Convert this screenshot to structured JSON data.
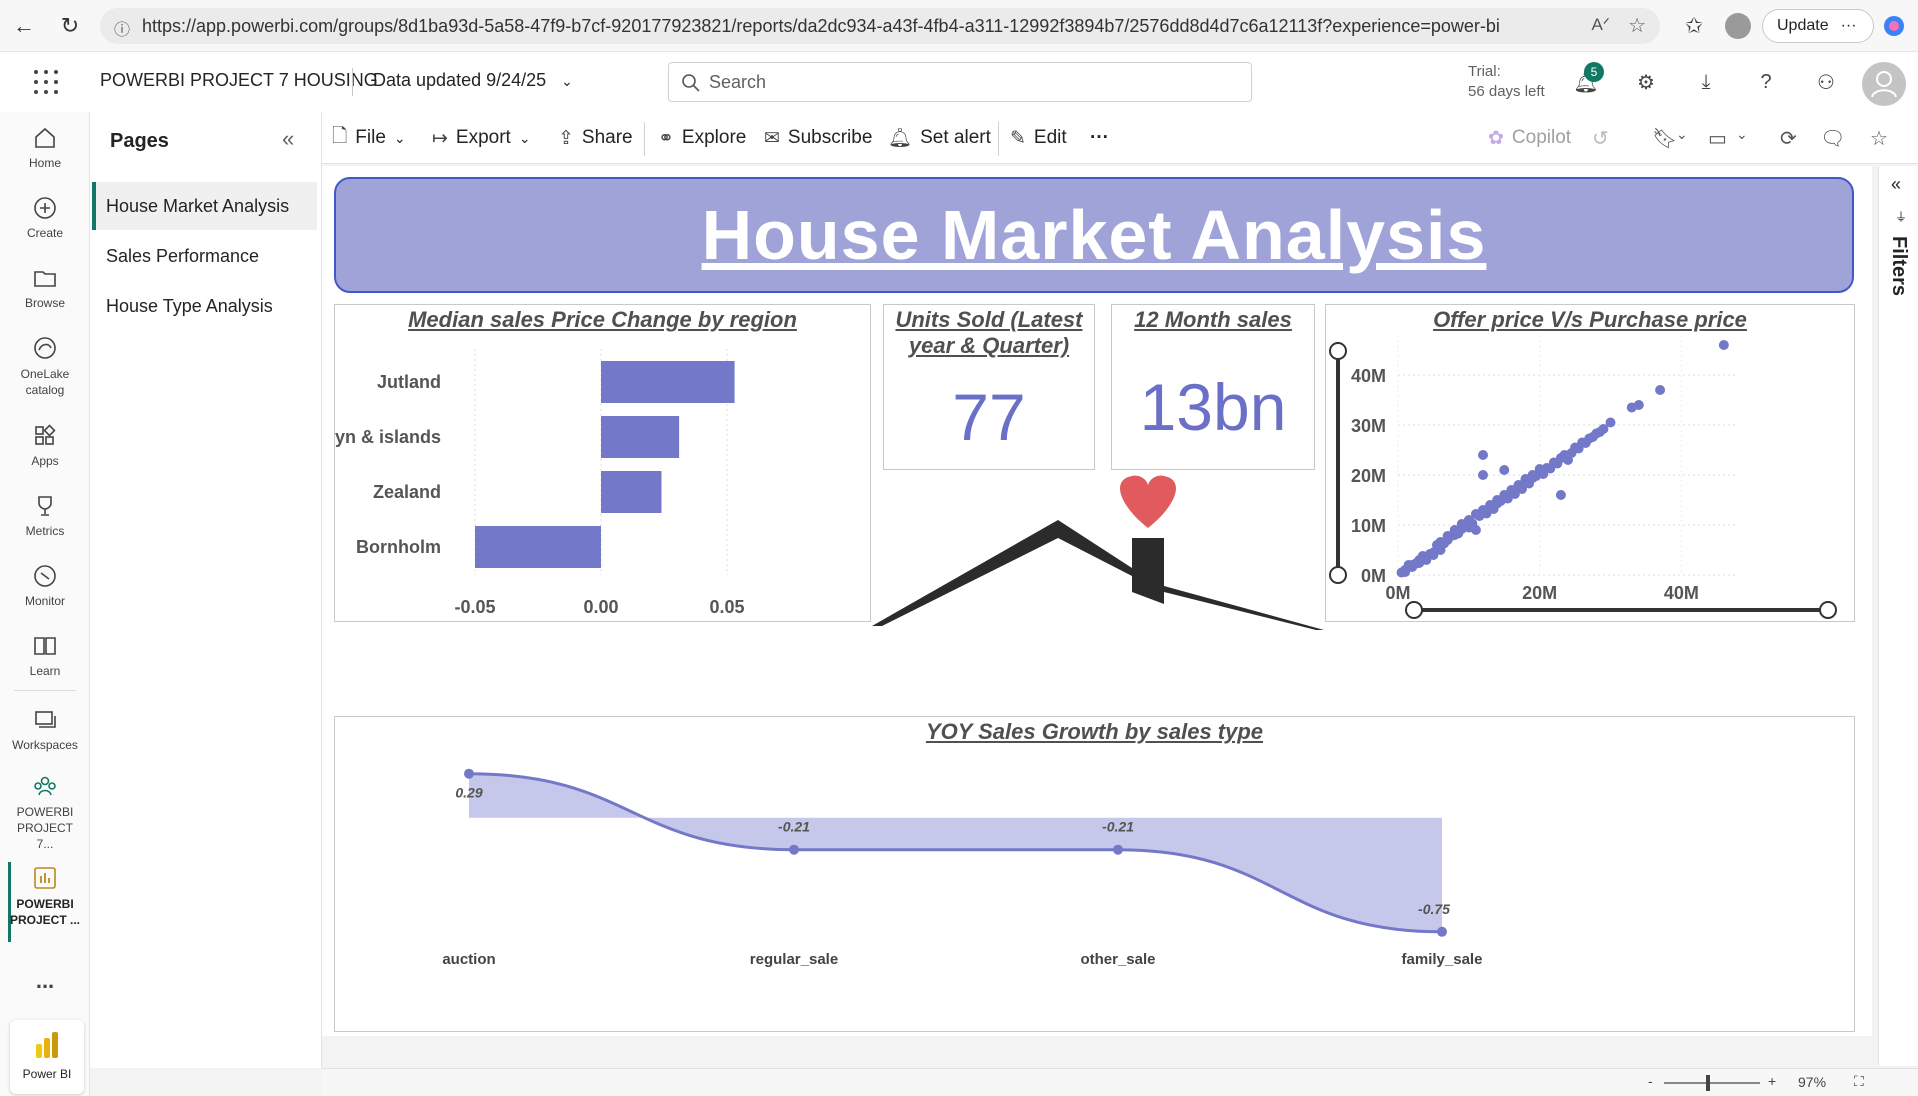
{
  "browser": {
    "url": "https://app.powerbi.com/groups/8d1ba93d-5a58-47f9-b7cf-920177923821/reports/da2dc934-a43f-4fb4-a311-12992f3894b7/2576dd8d4d7c6a12113f?experience=power-bi",
    "update_label": "Update"
  },
  "header": {
    "workspace_title": "POWERBI PROJECT 7 HOUSING",
    "data_updated": "Data updated 9/24/25",
    "search_placeholder": "Search",
    "trial_line1": "Trial:",
    "trial_line2": "56 days left",
    "notification_count": "5"
  },
  "rail": {
    "items": [
      {
        "label": "Home",
        "icon": "home-icon"
      },
      {
        "label": "Create",
        "icon": "plus-circle-icon"
      },
      {
        "label": "Browse",
        "icon": "folder-icon"
      },
      {
        "label": "OneLake catalog",
        "icon": "onelake-icon"
      },
      {
        "label": "Apps",
        "icon": "apps-icon"
      },
      {
        "label": "Metrics",
        "icon": "trophy-icon"
      },
      {
        "label": "Monitor",
        "icon": "monitor-icon"
      },
      {
        "label": "Learn",
        "icon": "book-icon"
      },
      {
        "label": "Workspaces",
        "icon": "workspaces-icon"
      },
      {
        "label": "POWERBI PROJECT 7...",
        "icon": "workspace-people-icon"
      },
      {
        "label": "POWERBI PROJECT ...",
        "icon": "report-icon"
      }
    ],
    "more": "...",
    "power_bi_label": "Power BI"
  },
  "pages": {
    "title": "Pages",
    "items": [
      "House Market Analysis",
      "Sales Performance",
      "House Type Analysis"
    ]
  },
  "toolbar": {
    "file": "File",
    "export": "Export",
    "share": "Share",
    "explore": "Explore",
    "subscribe": "Subscribe",
    "set_alert": "Set alert",
    "edit": "Edit",
    "more": "···",
    "copilot": "Copilot"
  },
  "report": {
    "banner_title": "House Market Analysis",
    "kpis": [
      {
        "title": "Units Sold (Latest year & Quarter)",
        "value": "77"
      },
      {
        "title": "12 Month sales",
        "value": "13bn"
      }
    ]
  },
  "filters_label": "Filters",
  "status": {
    "zoom": "97%",
    "minus": "-",
    "plus": "+"
  },
  "colors": {
    "accent": "#6a70c6",
    "bar": "#7378c8",
    "banner": "#9fa3d8",
    "heart": "#e05a5e",
    "house": "#2b2b2b"
  },
  "chart_data": [
    {
      "type": "bar",
      "orientation": "horizontal",
      "title": "Median sales Price Change by region",
      "categories": [
        "Jutland",
        "Fyn & islands",
        "Zealand",
        "Bornholm"
      ],
      "values": [
        0.053,
        0.031,
        0.024,
        -0.05
      ],
      "xlim": [
        -0.05,
        0.05
      ],
      "xticks": [
        "-0.05",
        "0.00",
        "0.05"
      ],
      "grid": true
    },
    {
      "type": "scatter",
      "title": "Offer price V/s Purchase price",
      "xticks": [
        "0M",
        "20M",
        "40M"
      ],
      "yticks": [
        "0M",
        "10M",
        "20M",
        "30M",
        "40M"
      ],
      "xlim": [
        0,
        48
      ],
      "ylim": [
        0,
        48
      ],
      "points": [
        [
          46,
          46
        ],
        [
          37,
          37
        ],
        [
          34,
          34
        ],
        [
          33,
          33.5
        ],
        [
          30,
          30.5
        ],
        [
          24,
          23
        ],
        [
          23,
          16
        ],
        [
          18,
          19
        ],
        [
          15,
          21
        ],
        [
          12,
          24
        ],
        [
          12,
          20
        ],
        [
          11,
          9
        ],
        [
          10,
          9.5
        ],
        [
          8,
          8
        ],
        [
          7,
          7
        ],
        [
          6,
          5
        ],
        [
          5,
          4.5
        ],
        [
          4,
          3.5
        ],
        [
          3,
          3
        ],
        [
          2,
          2
        ],
        [
          1,
          1
        ],
        [
          0.5,
          0.5
        ],
        [
          1.5,
          2
        ],
        [
          2.5,
          2.3
        ],
        [
          3.5,
          3.8
        ],
        [
          4.5,
          4.2
        ],
        [
          5.5,
          6
        ],
        [
          6.5,
          6.3
        ],
        [
          7.5,
          7.8
        ],
        [
          8.5,
          8.3
        ],
        [
          9,
          9.2
        ],
        [
          9.5,
          10
        ],
        [
          10.5,
          10.3
        ],
        [
          11.5,
          11.8
        ],
        [
          12.5,
          12.3
        ],
        [
          13,
          13.5
        ],
        [
          13.5,
          13.2
        ],
        [
          14,
          14.3
        ],
        [
          14.5,
          14.8
        ],
        [
          15.5,
          15.3
        ],
        [
          16,
          16.4
        ],
        [
          16.5,
          16.2
        ],
        [
          17,
          17.5
        ],
        [
          17.5,
          17.2
        ],
        [
          18.5,
          18.3
        ],
        [
          19,
          19.4
        ],
        [
          19.5,
          19.8
        ],
        [
          20,
          20.5
        ],
        [
          20.5,
          20.2
        ],
        [
          21,
          21.4
        ],
        [
          21.5,
          21.3
        ],
        [
          22,
          22.5
        ],
        [
          22.5,
          22.3
        ],
        [
          23,
          23.4
        ],
        [
          23.5,
          24
        ],
        [
          24.5,
          24.4
        ],
        [
          25,
          25.5
        ],
        [
          25.5,
          25.3
        ],
        [
          26,
          26.5
        ],
        [
          26.5,
          26.4
        ],
        [
          27,
          27.3
        ],
        [
          27.5,
          27.6
        ],
        [
          28,
          28.3
        ],
        [
          28.5,
          28.6
        ],
        [
          29,
          29.2
        ],
        [
          1,
          0.6
        ],
        [
          2,
          1.6
        ],
        [
          3,
          2.4
        ],
        [
          4,
          3
        ],
        [
          5,
          4
        ],
        [
          6,
          6.6
        ],
        [
          7,
          7.8
        ],
        [
          8,
          9
        ],
        [
          9,
          10.2
        ],
        [
          10,
          11
        ],
        [
          11,
          12.2
        ],
        [
          12,
          13
        ],
        [
          13,
          14
        ],
        [
          14,
          15
        ],
        [
          15,
          16
        ],
        [
          16,
          17
        ],
        [
          17,
          18
        ],
        [
          18,
          19.2
        ],
        [
          19,
          20
        ],
        [
          20,
          21.2
        ]
      ],
      "grid": true
    },
    {
      "type": "area",
      "title": "YOY Sales Growth by sales type",
      "categories": [
        "auction",
        "regular_sale",
        "other_sale",
        "family_sale"
      ],
      "values": [
        0.29,
        -0.21,
        -0.21,
        -0.75
      ],
      "data_labels": [
        "0.29",
        "-0.21",
        "-0.21",
        "-0.75"
      ]
    }
  ]
}
